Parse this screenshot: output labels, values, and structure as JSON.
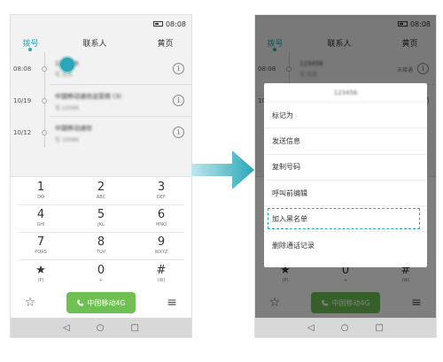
{
  "status": {
    "time": "08:08"
  },
  "tabs": {
    "dial": "拨号",
    "contacts": "联系人",
    "yellowpages": "黄页"
  },
  "calls": [
    {
      "time": "08:08",
      "name": "123456",
      "sub": "宅 北京",
      "status": "未接通"
    },
    {
      "time": "10/19",
      "name": "中国移动通信运营商 (3)",
      "sub": "宅 10086",
      "status": ""
    },
    {
      "time": "10/12",
      "name": "中国移动通信",
      "sub": "宅 10086",
      "status": ""
    }
  ],
  "info_icon": "i",
  "keypad": [
    {
      "digit": "1",
      "letters": "OO"
    },
    {
      "digit": "2",
      "letters": "ABC"
    },
    {
      "digit": "3",
      "letters": "DEF"
    },
    {
      "digit": "4",
      "letters": "GHI"
    },
    {
      "digit": "5",
      "letters": "JKL"
    },
    {
      "digit": "6",
      "letters": "MNO"
    },
    {
      "digit": "7",
      "letters": "PQRS"
    },
    {
      "digit": "8",
      "letters": "TUV"
    },
    {
      "digit": "9",
      "letters": "WXYZ"
    },
    {
      "digit": "★",
      "letters": "(P)"
    },
    {
      "digit": "0",
      "letters": "+"
    },
    {
      "digit": "#",
      "letters": "(W)"
    }
  ],
  "bottom": {
    "call_label": "中国移动4G",
    "star": "☆",
    "menu": "≡"
  },
  "nav": {
    "back": "◁",
    "home": "○",
    "recent": "□"
  },
  "dialog": {
    "title": "123456",
    "items": [
      "标记为",
      "发送信息",
      "复制号码",
      "呼叫前编辑",
      "加入黑名单",
      "删除通话记录"
    ],
    "highlighted_index": 4
  },
  "colors": {
    "accent": "#2aa7b8",
    "call_green": "#6fbf52"
  }
}
